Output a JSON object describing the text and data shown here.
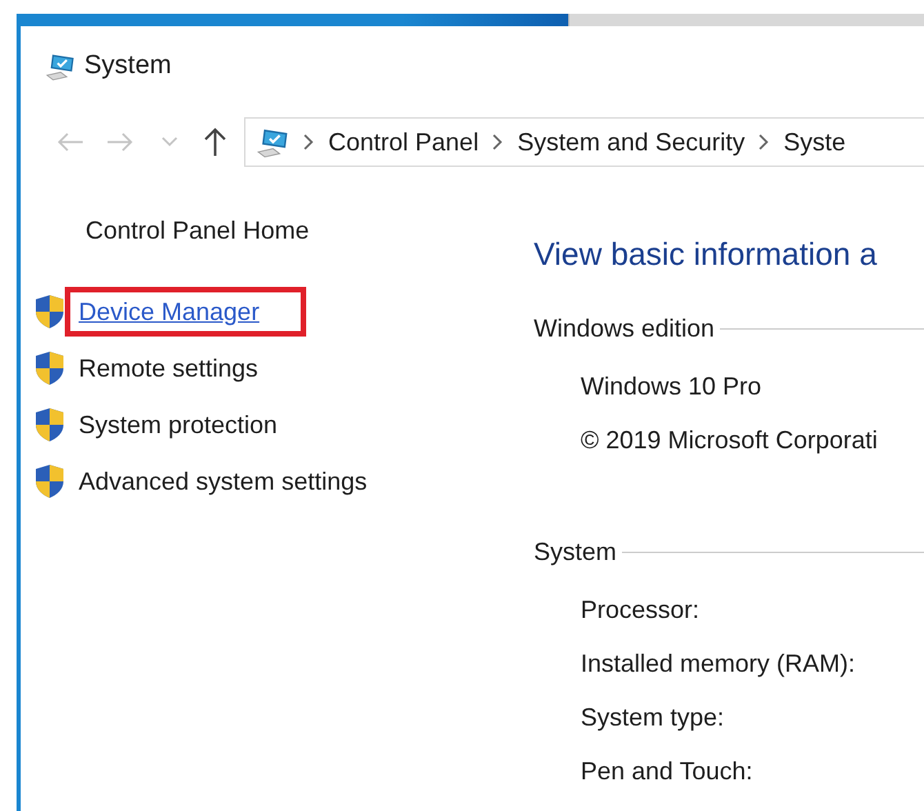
{
  "window": {
    "title": "System"
  },
  "address_bar": {
    "segments": [
      "Control Panel",
      "System and Security",
      "Syste"
    ]
  },
  "sidebar": {
    "home": "Control Panel Home",
    "links": [
      {
        "label": "Device Manager",
        "highlighted": true
      },
      {
        "label": "Remote settings",
        "highlighted": false
      },
      {
        "label": "System protection",
        "highlighted": false
      },
      {
        "label": "Advanced system settings",
        "highlighted": false
      }
    ]
  },
  "main": {
    "heading": "View basic information a",
    "sections": [
      {
        "title": "Windows edition",
        "rows": [
          {
            "label": "Windows 10 Pro"
          },
          {
            "label": "© 2019 Microsoft Corporati"
          }
        ]
      },
      {
        "title": "System",
        "rows": [
          {
            "label": "Processor:"
          },
          {
            "label": "Installed memory (RAM):"
          },
          {
            "label": "System type:"
          },
          {
            "label": "Pen and Touch:"
          }
        ]
      }
    ]
  }
}
